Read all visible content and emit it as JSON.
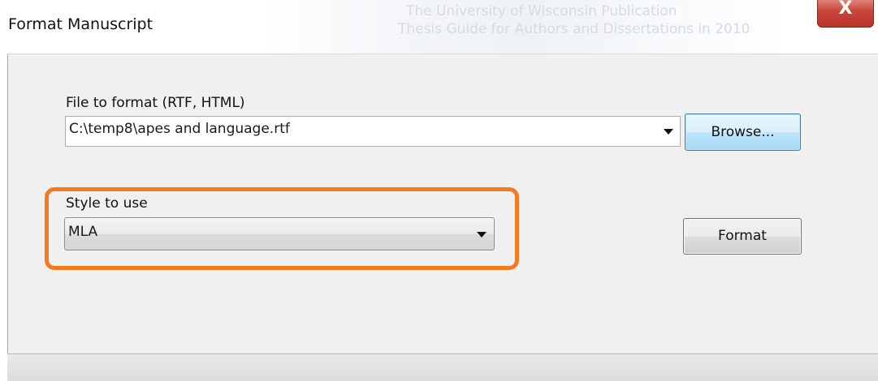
{
  "window": {
    "title": "Format Manuscript",
    "close_glyph": "X",
    "background_text": [
      "The University of Wisconsin Publication",
      "Thesis Guide for Authors and Dissertations in 2010"
    ]
  },
  "file_field": {
    "label": "File to format (RTF, HTML)",
    "value": "C:\\temp8\\apes and language.rtf",
    "dropdown_icon": "chevron-down-icon"
  },
  "browse_button": {
    "label": "Browse..."
  },
  "style_field": {
    "label": "Style to use",
    "selected": "MLA",
    "dropdown_icon": "chevron-down-icon"
  },
  "format_button": {
    "label": "Format"
  },
  "colors": {
    "highlight": "#f47a1f",
    "close_button": "#c9443a",
    "dialog_bg": "#f0f0f0",
    "browse_focus": "#3c7fb1"
  }
}
